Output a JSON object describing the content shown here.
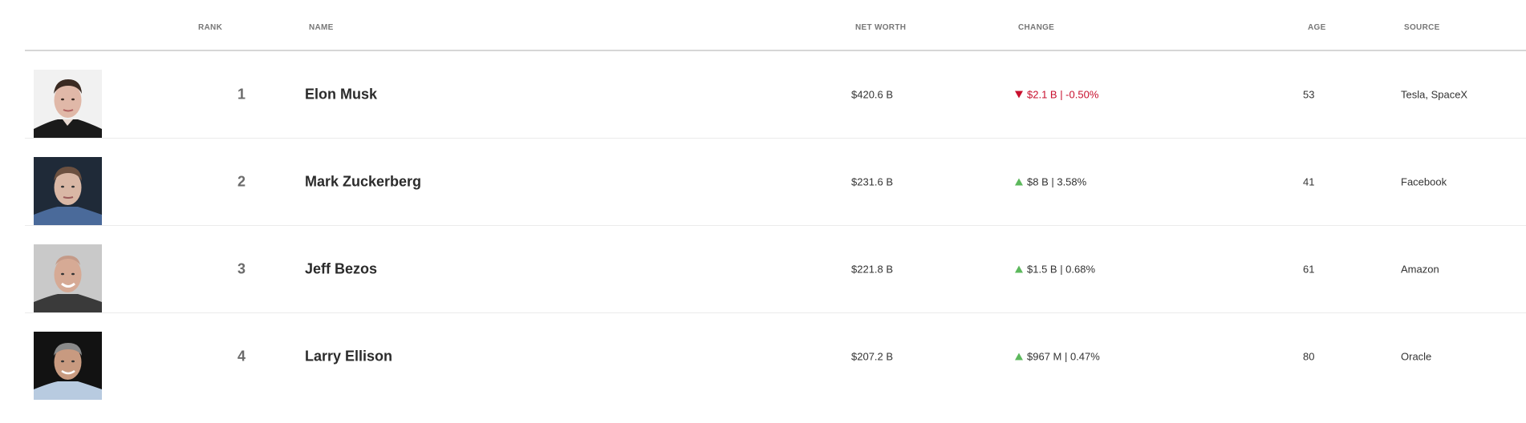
{
  "headers": {
    "rank": "RANK",
    "name": "NAME",
    "net_worth": "NET WORTH",
    "change": "CHANGE",
    "age": "AGE",
    "source": "SOURCE"
  },
  "rows": [
    {
      "rank": "1",
      "name": "Elon Musk",
      "net_worth": "$420.6 B",
      "change": "$2.1 B | -0.50%",
      "direction": "down",
      "age": "53",
      "source": "Tesla, SpaceX"
    },
    {
      "rank": "2",
      "name": "Mark Zuckerberg",
      "net_worth": "$231.6 B",
      "change": "$8 B | 3.58%",
      "direction": "up",
      "age": "41",
      "source": "Facebook"
    },
    {
      "rank": "3",
      "name": "Jeff Bezos",
      "net_worth": "$221.8 B",
      "change": "$1.5 B | 0.68%",
      "direction": "up",
      "age": "61",
      "source": "Amazon"
    },
    {
      "rank": "4",
      "name": "Larry Ellison",
      "net_worth": "$207.2 B",
      "change": "$967 M | 0.47%",
      "direction": "up",
      "age": "80",
      "source": "Oracle"
    }
  ],
  "colors": {
    "negative": "#c8102e",
    "positive_icon": "#5cb85c"
  }
}
